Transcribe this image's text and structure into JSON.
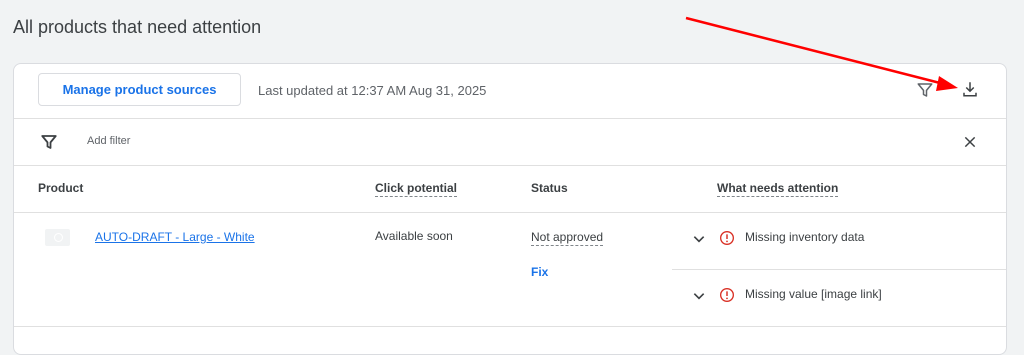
{
  "page": {
    "title": "All products that need attention"
  },
  "toolbar": {
    "manage_sources_label": "Manage product sources",
    "last_updated": "Last updated at 12:37 AM Aug 31, 2025",
    "filter_icon": "filter-icon",
    "download_icon": "download-icon"
  },
  "filterbar": {
    "add_filter_label": "Add filter",
    "close_icon": "close-icon"
  },
  "table": {
    "columns": [
      "Product",
      "Click potential",
      "Status",
      "What needs attention"
    ],
    "rows": [
      {
        "product": "AUTO-DRAFT - Large - White",
        "click_potential": "Available soon",
        "status": "Not approved",
        "action": "Fix",
        "issues": [
          "Missing inventory data",
          "Missing value [image link]"
        ]
      }
    ]
  },
  "colors": {
    "accent": "#1a73e8",
    "error": "#d93025",
    "annotation_arrow": "#ff0000"
  }
}
